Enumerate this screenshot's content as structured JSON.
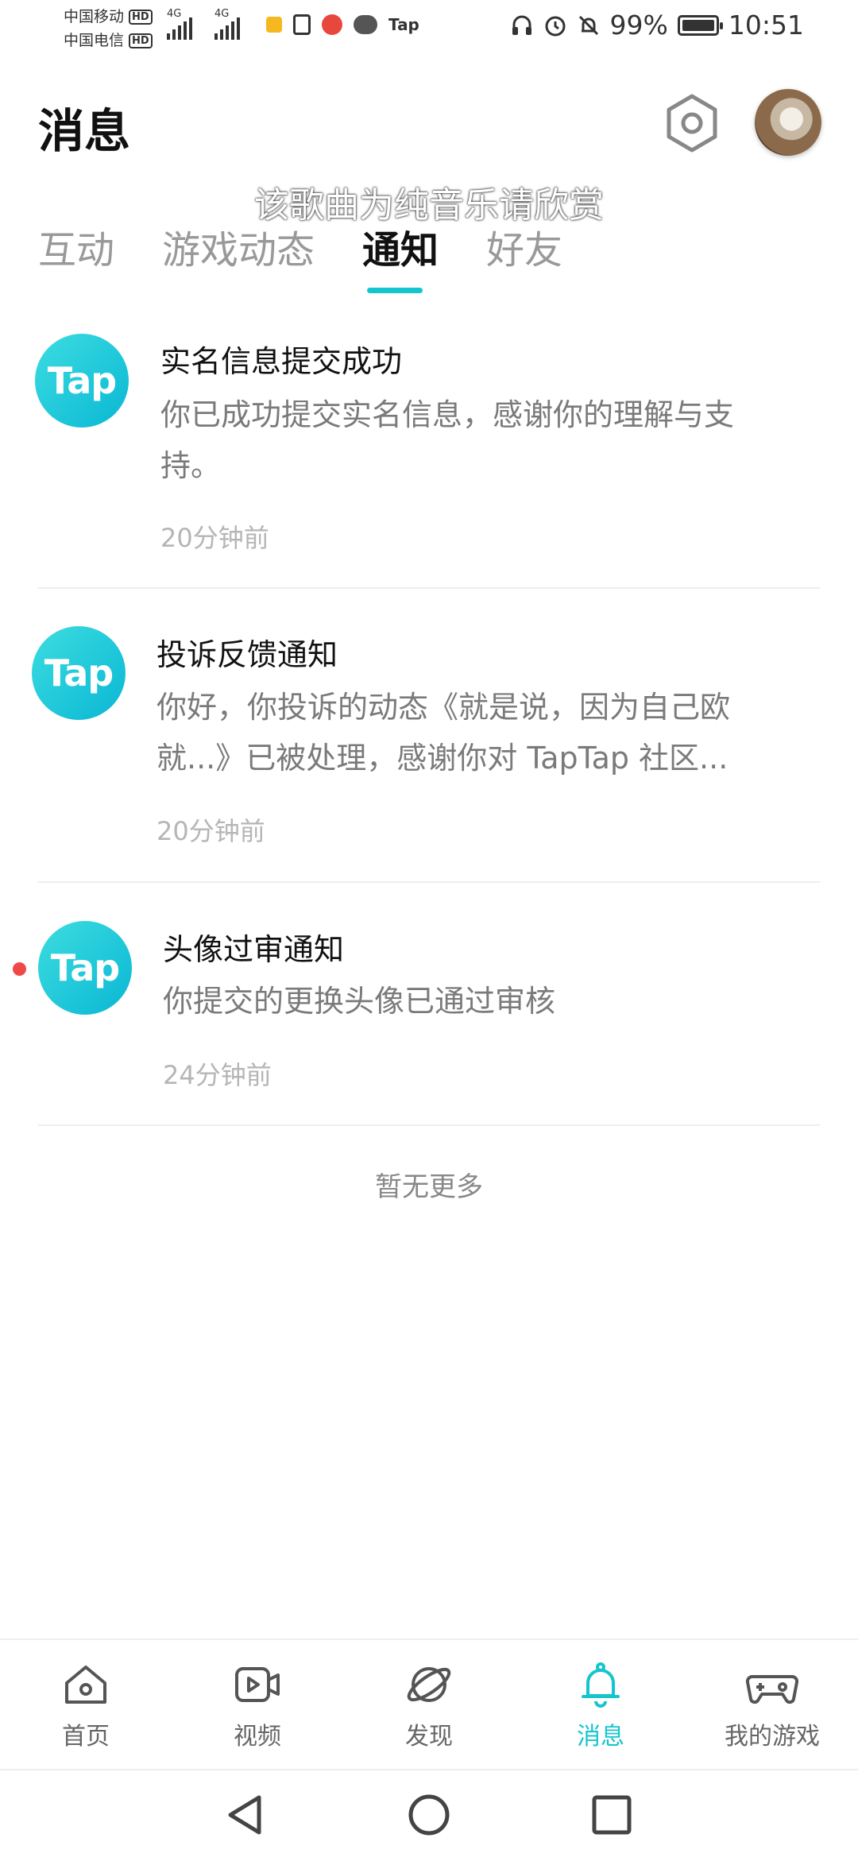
{
  "status_bar": {
    "carrier1": "中国移动",
    "carrier2": "中国电信",
    "hd": "HD",
    "network": "4G",
    "app_tap": "Tap",
    "battery_text": "99%",
    "battery_level": 0.99,
    "time": "10:51"
  },
  "header": {
    "title": "消息",
    "overlay_caption": "该歌曲为纯音乐请欣赏"
  },
  "tabs": [
    {
      "label": "互动",
      "active": false
    },
    {
      "label": "游戏动态",
      "active": false
    },
    {
      "label": "通知",
      "active": true
    },
    {
      "label": "好友",
      "active": false
    }
  ],
  "notifications": [
    {
      "logo": "Tap",
      "title": "实名信息提交成功",
      "body": "你已成功提交实名信息，感谢你的理解与支持。",
      "time": "20分钟前",
      "unread": false
    },
    {
      "logo": "Tap",
      "title": "投诉反馈通知",
      "body": "你好，你投诉的动态《就是说，因为自己欧就...》已被处理，感谢你对 TapTap 社区...",
      "time": "20分钟前",
      "unread": false
    },
    {
      "logo": "Tap",
      "title": "头像过审通知",
      "body": "你提交的更换头像已通过审核",
      "time": "24分钟前",
      "unread": true
    }
  ],
  "footer_text": "暂无更多",
  "bottom_nav": [
    {
      "label": "首页",
      "icon": "home-icon",
      "active": false
    },
    {
      "label": "视频",
      "icon": "video-icon",
      "active": false
    },
    {
      "label": "发现",
      "icon": "planet-icon",
      "active": false
    },
    {
      "label": "消息",
      "icon": "bell-icon",
      "active": true
    },
    {
      "label": "我的游戏",
      "icon": "gamepad-icon",
      "active": false
    }
  ],
  "colors": {
    "accent": "#15c5ce",
    "unread_dot": "#f04848",
    "logo_gradient_start": "#3ddde0",
    "logo_gradient_end": "#09b7d4"
  }
}
